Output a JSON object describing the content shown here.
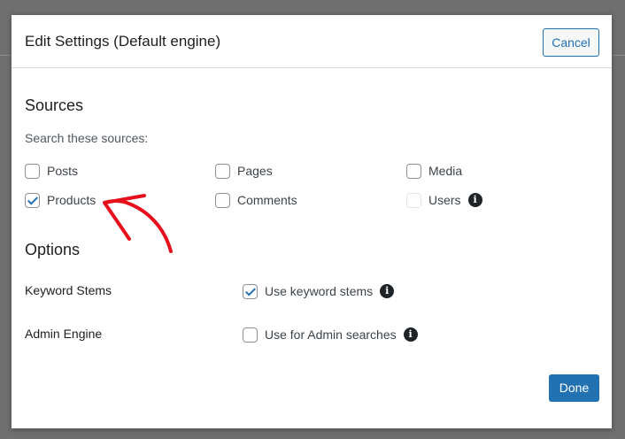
{
  "dialog": {
    "title": "Edit Settings (Default engine)",
    "cancel_label": "Cancel",
    "done_label": "Done"
  },
  "sources": {
    "heading": "Sources",
    "helper": "Search these sources:",
    "items": [
      {
        "label": "Posts",
        "checked": false
      },
      {
        "label": "Pages",
        "checked": false
      },
      {
        "label": "Media",
        "checked": false
      },
      {
        "label": "Products",
        "checked": true
      },
      {
        "label": "Comments",
        "checked": false
      },
      {
        "label": "Users",
        "checked": false,
        "disabled": true,
        "has_info": true
      }
    ]
  },
  "options": {
    "heading": "Options",
    "rows": [
      {
        "label": "Keyword Stems",
        "control_label": "Use keyword stems",
        "checked": true
      },
      {
        "label": "Admin Engine",
        "control_label": "Use for Admin searches",
        "checked": false
      }
    ]
  },
  "colors": {
    "accent": "#2271b1",
    "annotation": "#e8101c"
  }
}
